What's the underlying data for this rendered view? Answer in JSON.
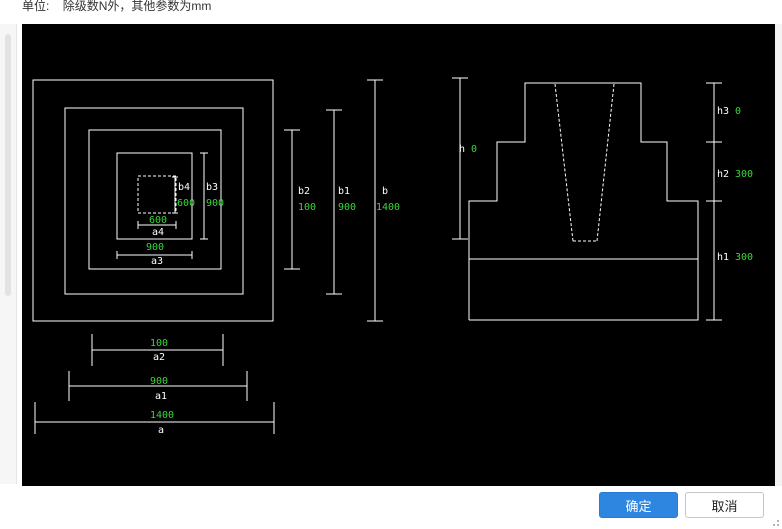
{
  "header": {
    "unit_label": "单位:",
    "unit_note": "除级数N外，其他参数为mm"
  },
  "plan_view": {
    "a4": {
      "label": "a4",
      "value": "600"
    },
    "b4": {
      "label": "b4",
      "value": "600"
    },
    "a3": {
      "label": "a3",
      "value": "900"
    },
    "b3": {
      "label": "b3",
      "value": "900"
    },
    "a2": {
      "label": "a2",
      "value": "100"
    },
    "b2": {
      "label": "b2",
      "value": "100"
    },
    "a1": {
      "label": "a1",
      "value": "900"
    },
    "b1": {
      "label": "b1",
      "value": "900"
    },
    "a": {
      "label": "a",
      "value": "1400"
    },
    "b": {
      "label": "b",
      "value": "1400"
    }
  },
  "section_view": {
    "h": {
      "label": "h",
      "value": "0"
    },
    "h3": {
      "label": "h3",
      "value": "0"
    },
    "h2": {
      "label": "h2",
      "value": "300"
    },
    "h1": {
      "label": "h1",
      "value": "300"
    }
  },
  "buttons": {
    "ok": "确定",
    "cancel": "取消"
  },
  "colors": {
    "canvas_bg": "#000000",
    "line": "#ffffff",
    "value_text": "#39d839",
    "primary": "#2f86e0"
  }
}
